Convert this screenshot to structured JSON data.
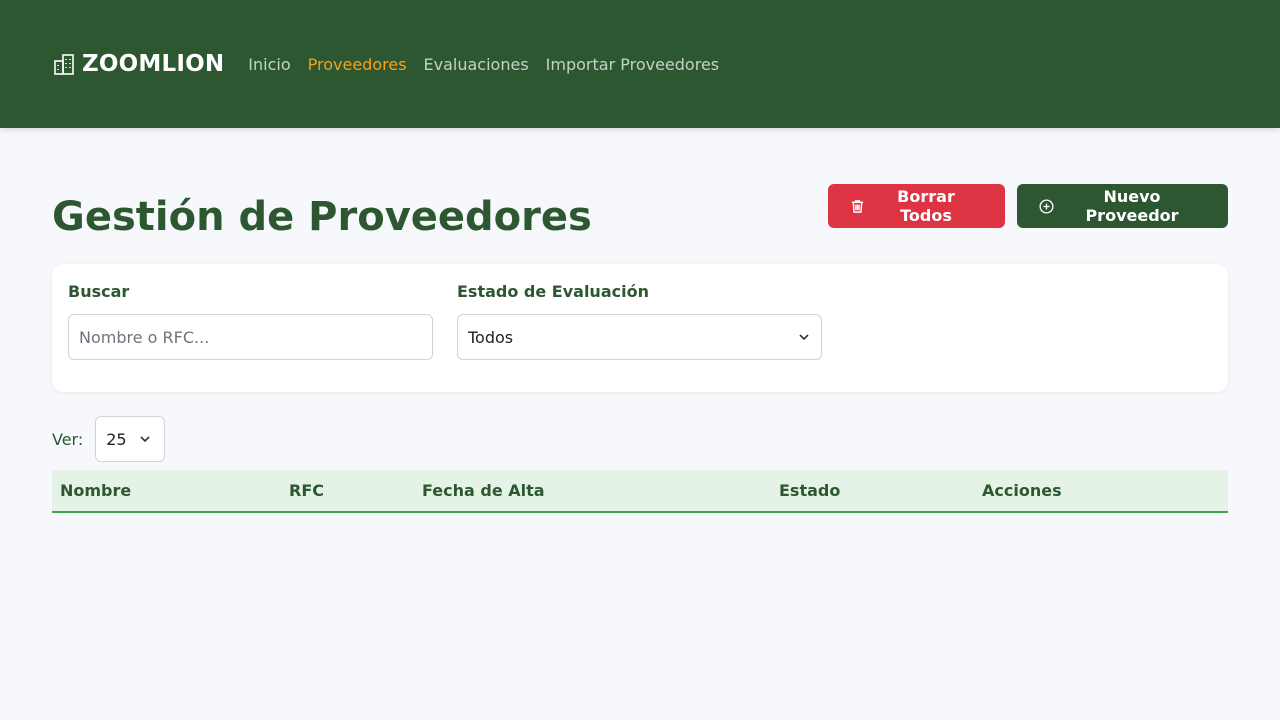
{
  "nav": {
    "brand": "ZOOMLION",
    "brand_icon": "building-icon",
    "links": [
      {
        "label": "Inicio",
        "active": false
      },
      {
        "label": "Proveedores",
        "active": true
      },
      {
        "label": "Evaluaciones",
        "active": false
      },
      {
        "label": "Importar Proveedores",
        "active": false
      }
    ],
    "colors": {
      "background": "#2d5731",
      "active": "#f5a21b"
    }
  },
  "page": {
    "title": "Gestión de Proveedores",
    "actions": {
      "delete_all": "Borrar Todos",
      "delete_icon": "trash-icon",
      "new_supplier": "Nuevo Proveedor",
      "new_icon": "plus-circle-icon"
    }
  },
  "filters": {
    "search_label": "Buscar",
    "search_placeholder": "Nombre o RFC...",
    "search_value": "",
    "status_label": "Estado de Evaluación",
    "status_selected": "Todos"
  },
  "view": {
    "label": "Ver:",
    "per_page": "25"
  },
  "table": {
    "columns": [
      "Nombre",
      "RFC",
      "Fecha de Alta",
      "Estado",
      "Acciones"
    ],
    "rows": []
  },
  "colors": {
    "danger": "#de3343",
    "primary": "#2d5731",
    "table_header_bg": "#e4f3e6",
    "table_header_border": "#3fa34d"
  }
}
